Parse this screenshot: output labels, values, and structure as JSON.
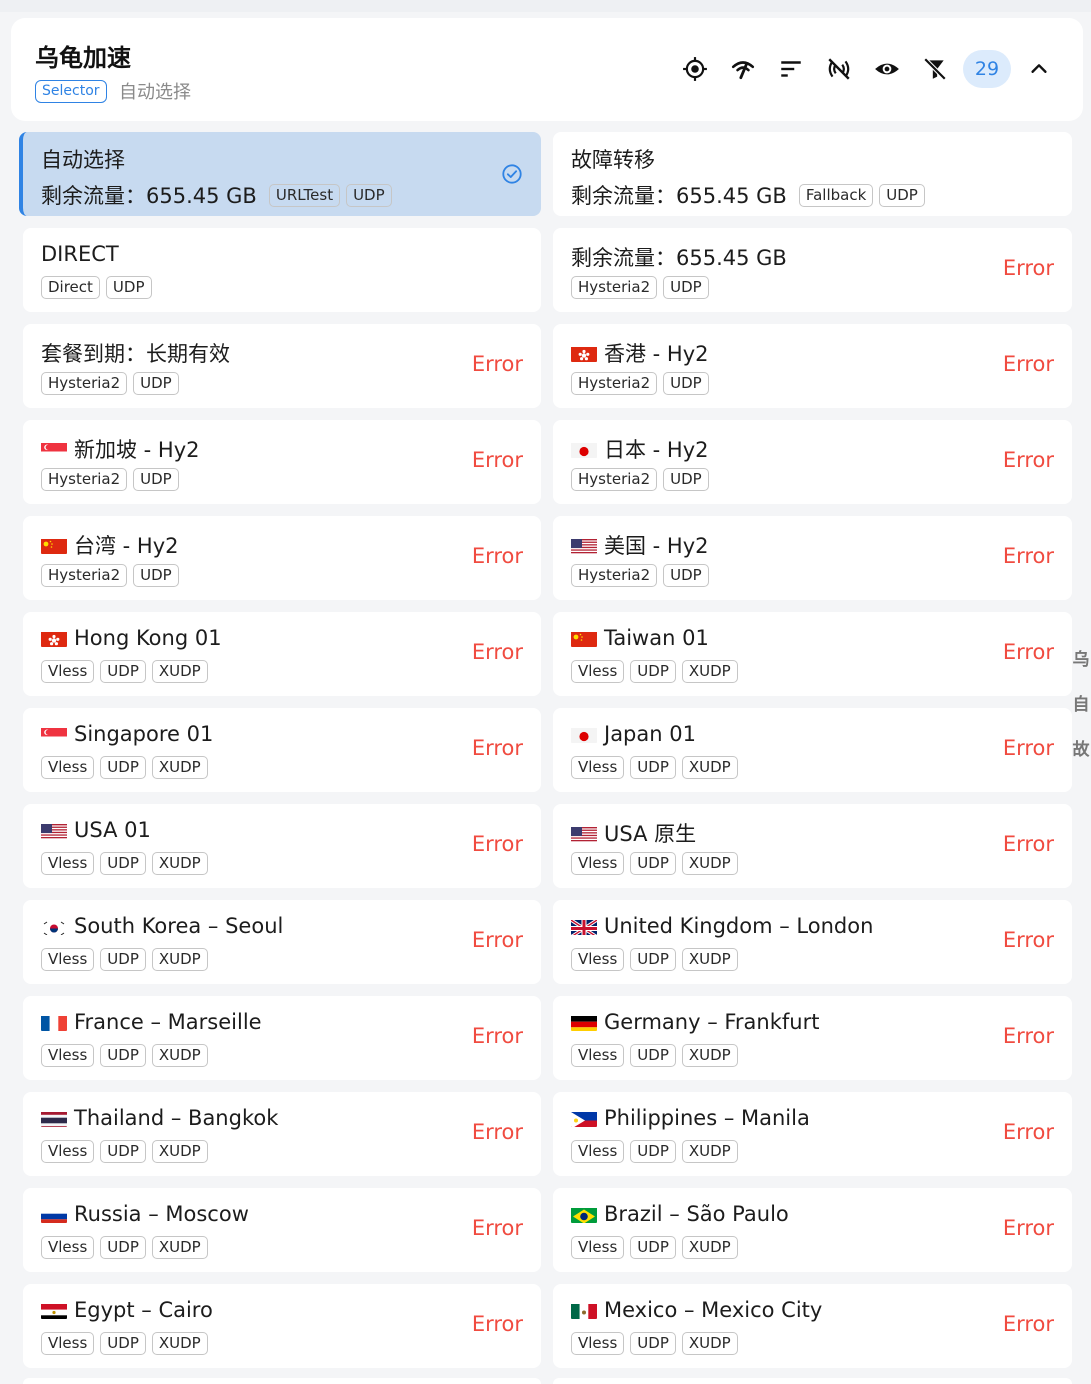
{
  "group": {
    "title": "乌龟加速",
    "type": "Selector",
    "current": "自动选择",
    "count": "29"
  },
  "toolbar": {
    "icons": [
      "locate-icon",
      "latency-test-icon",
      "sort-icon",
      "filter-signal-icon",
      "eye-icon",
      "filter-off-icon"
    ]
  },
  "colors": {
    "accent": "#2f83e4",
    "selected_bg": "#c7daf0",
    "error": "#f04b40"
  },
  "proxies": [
    {
      "name": "自动选择",
      "traffic": "剩余流量：655.45 GB",
      "tags": [
        "URLTest",
        "UDP"
      ],
      "status": "",
      "selected": true,
      "flag": ""
    },
    {
      "name": "故障转移",
      "traffic": "剩余流量：655.45 GB",
      "tags": [
        "Fallback",
        "UDP"
      ],
      "status": "",
      "selected": false,
      "flag": ""
    },
    {
      "name": "DIRECT",
      "traffic": "",
      "tags": [
        "Direct",
        "UDP"
      ],
      "status": "",
      "selected": false,
      "flag": ""
    },
    {
      "name": "剩余流量：655.45 GB",
      "traffic": "",
      "tags": [
        "Hysteria2",
        "UDP"
      ],
      "status": "Error",
      "selected": false,
      "flag": ""
    },
    {
      "name": "套餐到期：长期有效",
      "traffic": "",
      "tags": [
        "Hysteria2",
        "UDP"
      ],
      "status": "Error",
      "selected": false,
      "flag": ""
    },
    {
      "name": "香港 - Hy2",
      "traffic": "",
      "tags": [
        "Hysteria2",
        "UDP"
      ],
      "status": "Error",
      "selected": false,
      "flag": "hk"
    },
    {
      "name": "新加坡 - Hy2",
      "traffic": "",
      "tags": [
        "Hysteria2",
        "UDP"
      ],
      "status": "Error",
      "selected": false,
      "flag": "sg"
    },
    {
      "name": "日本 - Hy2",
      "traffic": "",
      "tags": [
        "Hysteria2",
        "UDP"
      ],
      "status": "Error",
      "selected": false,
      "flag": "jp"
    },
    {
      "name": "台湾 - Hy2",
      "traffic": "",
      "tags": [
        "Hysteria2",
        "UDP"
      ],
      "status": "Error",
      "selected": false,
      "flag": "cn"
    },
    {
      "name": "美国 - Hy2",
      "traffic": "",
      "tags": [
        "Hysteria2",
        "UDP"
      ],
      "status": "Error",
      "selected": false,
      "flag": "us"
    },
    {
      "name": "Hong Kong 01",
      "traffic": "",
      "tags": [
        "Vless",
        "UDP",
        "XUDP"
      ],
      "status": "Error",
      "selected": false,
      "flag": "hk"
    },
    {
      "name": "Taiwan 01",
      "traffic": "",
      "tags": [
        "Vless",
        "UDP",
        "XUDP"
      ],
      "status": "Error",
      "selected": false,
      "flag": "cn"
    },
    {
      "name": "Singapore 01",
      "traffic": "",
      "tags": [
        "Vless",
        "UDP",
        "XUDP"
      ],
      "status": "Error",
      "selected": false,
      "flag": "sg"
    },
    {
      "name": "Japan 01",
      "traffic": "",
      "tags": [
        "Vless",
        "UDP",
        "XUDP"
      ],
      "status": "Error",
      "selected": false,
      "flag": "jp"
    },
    {
      "name": "USA 01",
      "traffic": "",
      "tags": [
        "Vless",
        "UDP",
        "XUDP"
      ],
      "status": "Error",
      "selected": false,
      "flag": "us"
    },
    {
      "name": "USA 原生",
      "traffic": "",
      "tags": [
        "Vless",
        "UDP",
        "XUDP"
      ],
      "status": "Error",
      "selected": false,
      "flag": "us"
    },
    {
      "name": "South Korea – Seoul",
      "traffic": "",
      "tags": [
        "Vless",
        "UDP",
        "XUDP"
      ],
      "status": "Error",
      "selected": false,
      "flag": "kr"
    },
    {
      "name": "United Kingdom – London",
      "traffic": "",
      "tags": [
        "Vless",
        "UDP",
        "XUDP"
      ],
      "status": "Error",
      "selected": false,
      "flag": "gb"
    },
    {
      "name": "France – Marseille",
      "traffic": "",
      "tags": [
        "Vless",
        "UDP",
        "XUDP"
      ],
      "status": "Error",
      "selected": false,
      "flag": "fr"
    },
    {
      "name": "Germany – Frankfurt",
      "traffic": "",
      "tags": [
        "Vless",
        "UDP",
        "XUDP"
      ],
      "status": "Error",
      "selected": false,
      "flag": "de"
    },
    {
      "name": "Thailand – Bangkok",
      "traffic": "",
      "tags": [
        "Vless",
        "UDP",
        "XUDP"
      ],
      "status": "Error",
      "selected": false,
      "flag": "th"
    },
    {
      "name": "Philippines – Manila",
      "traffic": "",
      "tags": [
        "Vless",
        "UDP",
        "XUDP"
      ],
      "status": "Error",
      "selected": false,
      "flag": "ph"
    },
    {
      "name": "Russia – Moscow",
      "traffic": "",
      "tags": [
        "Vless",
        "UDP",
        "XUDP"
      ],
      "status": "Error",
      "selected": false,
      "flag": "ru"
    },
    {
      "name": "Brazil – São Paulo",
      "traffic": "",
      "tags": [
        "Vless",
        "UDP",
        "XUDP"
      ],
      "status": "Error",
      "selected": false,
      "flag": "br"
    },
    {
      "name": "Egypt – Cairo",
      "traffic": "",
      "tags": [
        "Vless",
        "UDP",
        "XUDP"
      ],
      "status": "Error",
      "selected": false,
      "flag": "eg"
    },
    {
      "name": "Mexico – Mexico City",
      "traffic": "",
      "tags": [
        "Vless",
        "UDP",
        "XUDP"
      ],
      "status": "Error",
      "selected": false,
      "flag": "mx"
    }
  ],
  "side_index": [
    "乌",
    "自",
    "故"
  ]
}
